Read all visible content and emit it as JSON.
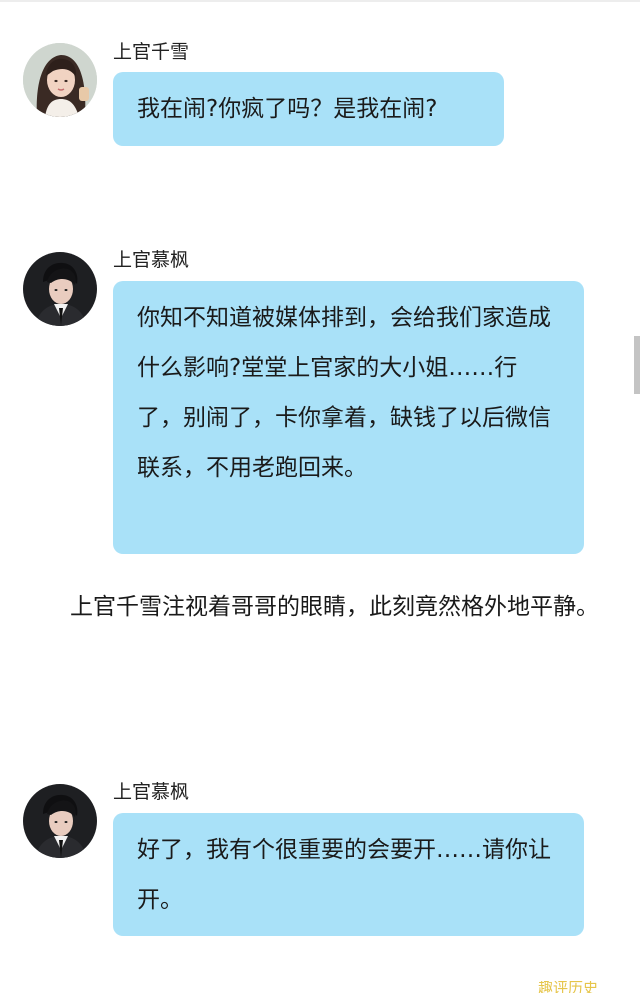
{
  "messages": [
    {
      "sender": "上官千雪",
      "avatar_icon": "female-avatar-icon",
      "text": "我在闹?你疯了吗？是我在闹?"
    },
    {
      "sender": "上官慕枫",
      "avatar_icon": "male-avatar-icon",
      "text": "你知不知道被媒体排到，会给我们家造成什么影响?堂堂上官家的大小姐……行了，别闹了，卡你拿着，缺钱了以后微信联系，不用老跑回来。"
    },
    {
      "sender": "上官慕枫",
      "avatar_icon": "male-avatar-icon",
      "text": "好了，我有个很重要的会要开……请你让开。"
    }
  ],
  "narration": "上官千雪注视着哥哥的眼睛，此刻竟然格外地平静。",
  "watermark": "趣评历史",
  "colors": {
    "bubble": "#a9e1f8",
    "background": "#ffffff",
    "text": "#1a1a1a"
  }
}
